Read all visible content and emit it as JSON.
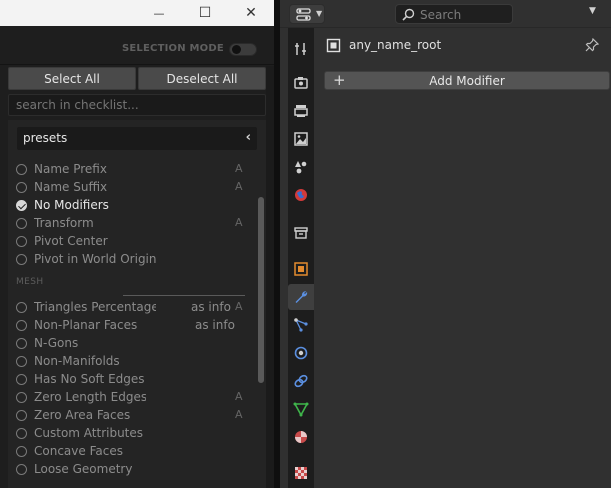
{
  "window": {
    "minimize_glyph": "—",
    "maximize_glyph": "☐",
    "close_glyph": "✕"
  },
  "checklist": {
    "selection_mode_label": "SELECTION MODE",
    "selection_mode_on": false,
    "select_all_label": "Select All",
    "deselect_all_label": "Deselect All",
    "search_placeholder": "search in checklist...",
    "presets_label": "presets",
    "general_items": [
      {
        "label": "Name Prefix",
        "flag": "A",
        "checked": false
      },
      {
        "label": "Name Suffix",
        "flag": "A",
        "checked": false
      },
      {
        "label": "No Modifiers",
        "flag": "",
        "checked": true
      },
      {
        "label": "Transform",
        "flag": "A",
        "checked": false
      },
      {
        "label": "Pivot Center",
        "flag": "",
        "checked": false
      },
      {
        "label": "Pivot in World Origin",
        "flag": "",
        "checked": false
      }
    ],
    "mesh_header": "MESH",
    "mesh_items": [
      {
        "label": "Triangles Percentage",
        "info": "as info",
        "flag": "A",
        "checked": false
      },
      {
        "label": "Non-Planar Faces",
        "info": "as info",
        "flag": "",
        "checked": false
      },
      {
        "label": "N-Gons",
        "info": "",
        "flag": "",
        "checked": false
      },
      {
        "label": "Non-Manifolds",
        "info": "",
        "flag": "",
        "checked": false
      },
      {
        "label": "Has No Soft Edges",
        "info": "",
        "flag": "",
        "checked": false
      },
      {
        "label": "Zero Length Edges",
        "info": "",
        "flag": "A",
        "checked": false
      },
      {
        "label": "Zero Area Faces",
        "info": "",
        "flag": "A",
        "checked": false
      },
      {
        "label": "Custom Attributes",
        "info": "",
        "flag": "",
        "checked": false
      },
      {
        "label": "Concave Faces",
        "info": "",
        "flag": "",
        "checked": false
      },
      {
        "label": "Loose Geometry",
        "info": "",
        "flag": "",
        "checked": false
      }
    ]
  },
  "properties": {
    "search_placeholder": "Search",
    "object_name": "any_name_root",
    "add_modifier_label": "Add Modifier",
    "add_modifier_plus": "+",
    "tabs": [
      {
        "name": "tab-tool",
        "icon": "tool-icon",
        "active": false
      },
      {
        "name": "tab-render",
        "icon": "render-icon",
        "active": false
      },
      {
        "name": "tab-output",
        "icon": "output-icon",
        "active": false
      },
      {
        "name": "tab-view-layer",
        "icon": "view-layer-icon",
        "active": false
      },
      {
        "name": "tab-scene",
        "icon": "scene-icon",
        "active": false
      },
      {
        "name": "tab-world",
        "icon": "world-icon",
        "active": false
      },
      {
        "name": "tab-collection",
        "icon": "collection-icon",
        "active": false
      },
      {
        "name": "tab-object",
        "icon": "object-icon",
        "active": false
      },
      {
        "name": "tab-modifiers",
        "icon": "wrench-icon",
        "active": true
      },
      {
        "name": "tab-particles",
        "icon": "particles-icon",
        "active": false
      },
      {
        "name": "tab-physics",
        "icon": "physics-icon",
        "active": false
      },
      {
        "name": "tab-constraints",
        "icon": "constraints-icon",
        "active": false
      },
      {
        "name": "tab-data",
        "icon": "mesh-data-icon",
        "active": false
      },
      {
        "name": "tab-material",
        "icon": "material-icon",
        "active": false
      },
      {
        "name": "tab-texture",
        "icon": "texture-icon",
        "active": false
      }
    ],
    "colors": {
      "accent_blue": "#4772b3",
      "object_orange": "#e38b2e",
      "mesh_green": "#3fb64b",
      "material_red": "#c84b4b",
      "world_red": "#d23a3a"
    }
  }
}
